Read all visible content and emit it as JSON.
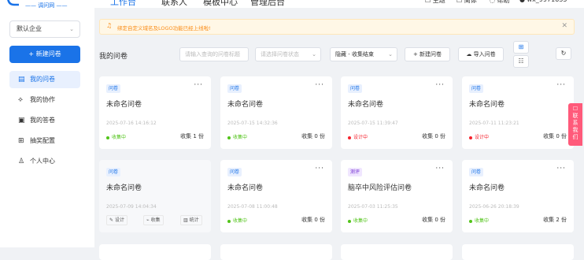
{
  "header": {
    "logo_text": "—— 调问网 ——",
    "tabs": [
      "工作台",
      "联系人",
      "模板中心",
      "管理后台"
    ],
    "right_items": [
      "主题",
      "简体",
      "帮助",
      "wx_9971635"
    ]
  },
  "sidebar": {
    "enterprise": "默认企业",
    "new_button": "+ 新建问卷",
    "items": [
      {
        "label": "我的问卷",
        "icon": "list-icon"
      },
      {
        "label": "我的协作",
        "icon": "link-icon"
      },
      {
        "label": "我的答卷",
        "icon": "clipboard-icon"
      },
      {
        "label": "抽奖配置",
        "icon": "gift-icon"
      },
      {
        "label": "个人中心",
        "icon": "user-icon"
      }
    ]
  },
  "notice": {
    "text": "绑定自定义域名及LOGO功能已经上线啦!"
  },
  "toolbar": {
    "title": "我的问卷",
    "search_placeholder": "请输入查询的问卷标题",
    "status_placeholder": "请选择问卷状态",
    "filter_value": "隐藏 - 收集结束",
    "new_label": "+ 新建问卷",
    "import_label": "导入问卷"
  },
  "cards": [
    {
      "tag": "问卷",
      "title": "未命名问卷",
      "date": "2025-07-16 14:16:12",
      "status": "收集中",
      "count": "收集 1 份"
    },
    {
      "tag": "问卷",
      "title": "未命名问卷",
      "date": "2025-07-15 14:32:36",
      "status": "收集中",
      "count": "收集 0 份"
    },
    {
      "tag": "问卷",
      "title": "未命名问卷",
      "date": "2025-07-15 11:39:47",
      "status": "设计中",
      "count": "收集 0 份"
    },
    {
      "tag": "问卷",
      "title": "未命名问卷",
      "date": "2025-07-11 11:23:21",
      "status": "设计中",
      "count": "收集 0 份"
    },
    {
      "tag": "问卷",
      "title": "未命名问卷",
      "date": "2025-07-09 14:04:34",
      "actions": [
        "设计",
        "收集",
        "统计"
      ]
    },
    {
      "tag": "问卷",
      "title": "未命名问卷",
      "date": "2025-07-08 11:00:48",
      "status": "收集中",
      "count": "收集 0 份"
    },
    {
      "tag": "测评",
      "title": "脑卒中风险评估问卷",
      "date": "2025-07-03 11:25:35",
      "status": "收集中",
      "count": "收集 0 份"
    },
    {
      "tag": "问卷",
      "title": "未命名问卷",
      "date": "2025-06-26 20:18:39",
      "status": "收集中",
      "count": "收集 2 份"
    }
  ],
  "float_contact": "联系我们",
  "colors": {
    "accent": "#1a73e8",
    "collecting": "#52c41a",
    "designing": "#f5222d",
    "float": "#ff5a7a"
  }
}
